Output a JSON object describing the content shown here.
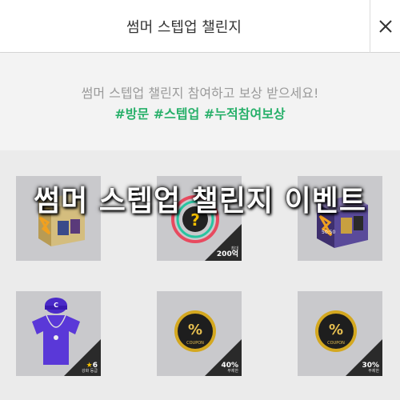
{
  "header": {
    "title": "썸머 스텝업 챌린지",
    "close_icon": "close-icon"
  },
  "banner": {
    "text": "썸머 스텝업 챌린지 참여하고 보상 받으세요!",
    "tags": "#방문 #스텝업 #누적참여보상",
    "tag_color": "#28b06a"
  },
  "overlay": {
    "title": "썸머 스텝업 챌린지 이벤트"
  },
  "rewards": [
    {
      "name": "summer-stepup-box",
      "label": ""
    },
    {
      "name": "mystery-reward",
      "label": "200억",
      "sublabel": "최대"
    },
    {
      "name": "50-50-box",
      "label": ""
    },
    {
      "name": "team-kit-reward",
      "label": "6",
      "sublabel": "강화 등급"
    },
    {
      "name": "coupon-40",
      "label": "40%",
      "sublabel": "무제한"
    },
    {
      "name": "coupon-30",
      "label": "30%",
      "sublabel": "무제한"
    }
  ]
}
